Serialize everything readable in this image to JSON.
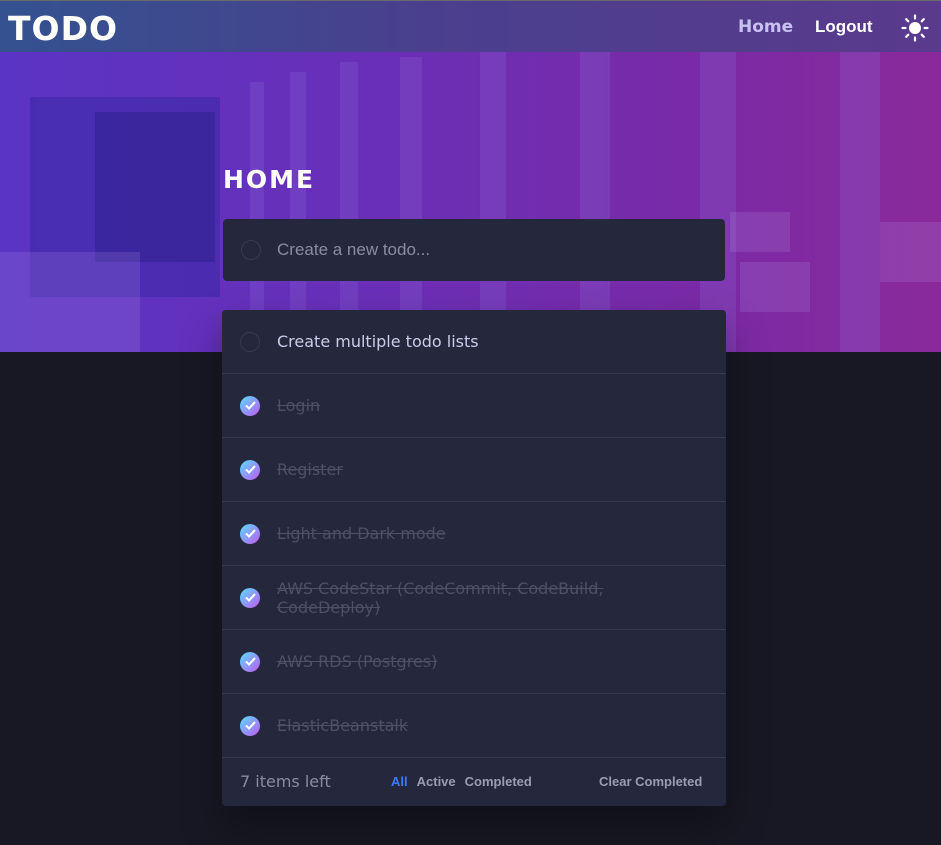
{
  "nav": {
    "brand": "TODO",
    "home_label": "Home",
    "logout_label": "Logout",
    "theme_icon": "sun-icon"
  },
  "main": {
    "title": "HOME",
    "new_todo_placeholder": "Create a new todo..."
  },
  "todos": [
    {
      "text": "Create multiple todo lists",
      "completed": false
    },
    {
      "text": "Login",
      "completed": true
    },
    {
      "text": "Register",
      "completed": true
    },
    {
      "text": "Light and Dark mode",
      "completed": true
    },
    {
      "text": "AWS CodeStar (CodeCommit, CodeBuild, CodeDeploy)",
      "completed": true
    },
    {
      "text": "AWS RDS (Postgres)",
      "completed": true
    },
    {
      "text": "ElasticBeanstalk",
      "completed": true
    }
  ],
  "footer": {
    "items_left": "7 items left",
    "filters": [
      "All",
      "Active",
      "Completed"
    ],
    "active_filter": "All",
    "clear_label": "Clear Completed"
  },
  "colors": {
    "accent": "#3a7bfd",
    "card": "#25273c",
    "background": "#181824",
    "check_gradient_start": "#57ddff",
    "check_gradient_end": "#c058f3"
  }
}
